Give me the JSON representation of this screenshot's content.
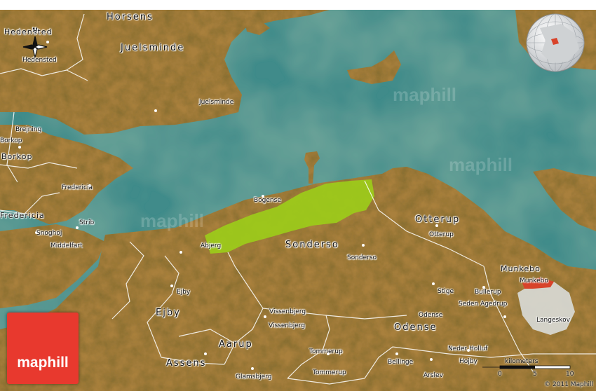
{
  "brand": {
    "label": "maphill",
    "color": "#e8392e"
  },
  "watermark": "maphill",
  "compass": {
    "n": "N",
    "label": "Hedensted"
  },
  "scale": {
    "title": "kilometers",
    "ticks": [
      "0",
      "5",
      "10"
    ]
  },
  "copyright": "© 2011 Maphill",
  "colors": {
    "water": "#3f8b8a",
    "land": "#a9803d",
    "highlight": "#9ccc1a",
    "borders": "#ffffff"
  },
  "labels": {
    "horsens": "Horsens",
    "hedensted": "Hedensted",
    "hedensted_sm": "Hedensted",
    "juelsminde": "Juelsminde",
    "juelsminde_sm": "Juelsminde",
    "brejning": "Brejning",
    "borkop_sm": "Borkop",
    "borkop": "Borkop",
    "fredericia_sm": "Fredericia",
    "fredericia": "Fredericia",
    "strib": "Strib",
    "snoghoj": "Snoghoj",
    "middelfart": "Middelfart",
    "bogense": "Bogense",
    "abjerg": "Abjerg",
    "sonderso": "Sonderso",
    "sonderso_sm": "Sonderso",
    "otterup": "Otterup",
    "otterup_sm": "Otterup",
    "munkebo": "Munkebo",
    "munkebo_sm": "Munkebo",
    "stige": "Stige",
    "bullerup": "Bullerup",
    "seden": "Seden Agedrup",
    "odense_sm": "Odense",
    "odense": "Odense",
    "ejby_sm": "Ejby",
    "ejby": "Ejby",
    "vissenbjerg_sm": "Vissenbjerg",
    "vissenbjerg": "Vissenbjerg",
    "aarup": "Aarup",
    "assens": "Assens",
    "tommerup_sm": "Tommerup",
    "tommerup": "Tommerup",
    "glamsbjerg": "Glamsbjerg",
    "bellinge": "Bellinge",
    "arslev": "Arslev",
    "neder": "Neder Holluf",
    "hojby": "Hojby",
    "langeskov": "Langeskov"
  }
}
